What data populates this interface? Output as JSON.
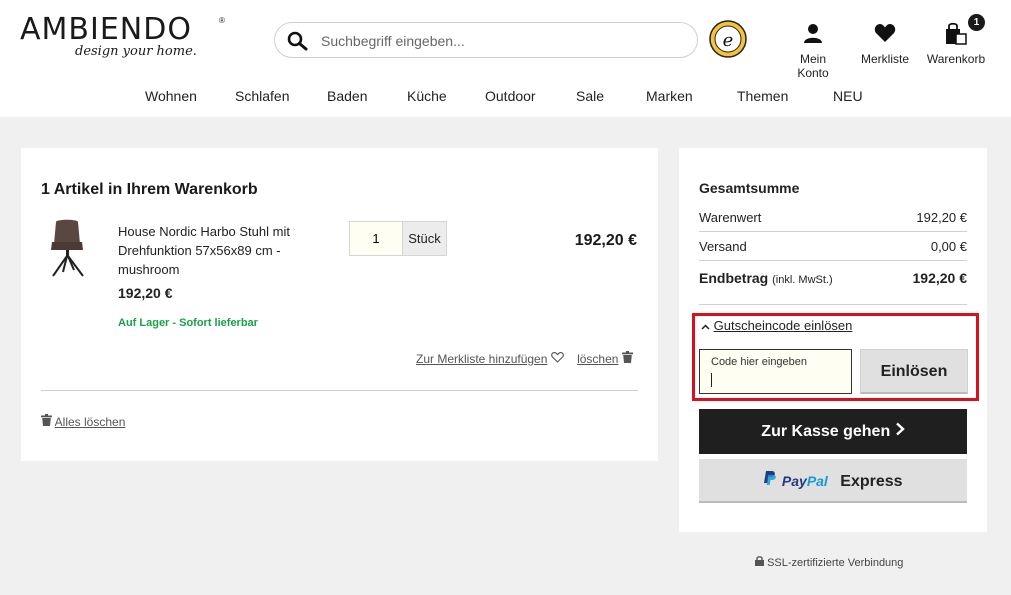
{
  "header": {
    "logo_text": "AMBIENDO",
    "logo_registered": "®",
    "logo_tagline": "design your home.",
    "search_placeholder": "Suchbegriff eingeben...",
    "account_label": "Mein Konto",
    "wishlist_label": "Merkliste",
    "cart_label": "Warenkorb",
    "cart_count": "1"
  },
  "nav": [
    "Wohnen",
    "Schlafen",
    "Baden",
    "Küche",
    "Outdoor",
    "Sale",
    "Marken",
    "Themen",
    "NEU"
  ],
  "cart": {
    "title": "1 Artikel in Ihrem Warenkorb",
    "item": {
      "name": "House Nordic Harbo Stuhl mit Drehfunktion 57x56x89 cm - mushroom",
      "price": "192,20 €",
      "stock": "Auf Lager - Sofort lieferbar",
      "quantity": "1",
      "unit": "Stück",
      "line_total": "192,20 €",
      "wishlist_link": "Zur Merkliste hinzufügen",
      "delete_link": "löschen"
    },
    "clear_all": "Alles löschen"
  },
  "summary": {
    "title": "Gesamtsumme",
    "goods_label": "Warenwert",
    "goods_value": "192,20 €",
    "shipping_label": "Versand",
    "shipping_value": "0,00 €",
    "total_label": "Endbetrag",
    "total_note": "(inkl. MwSt.)",
    "total_value": "192,20 €",
    "coupon_toggle": "Gutscheincode einlösen",
    "coupon_label": "Code hier eingeben",
    "coupon_button": "Einlösen",
    "checkout_button": "Zur Kasse gehen",
    "paypal_pay": "Pay",
    "paypal_pal": "Pal",
    "paypal_express": "Express"
  },
  "ssl_text": "SSL-zertifizierte Verbindung",
  "colors": {
    "stock_green": "#1aa04a",
    "highlight_red": "#d9111c",
    "checkout_bg": "#1f1f1f"
  }
}
